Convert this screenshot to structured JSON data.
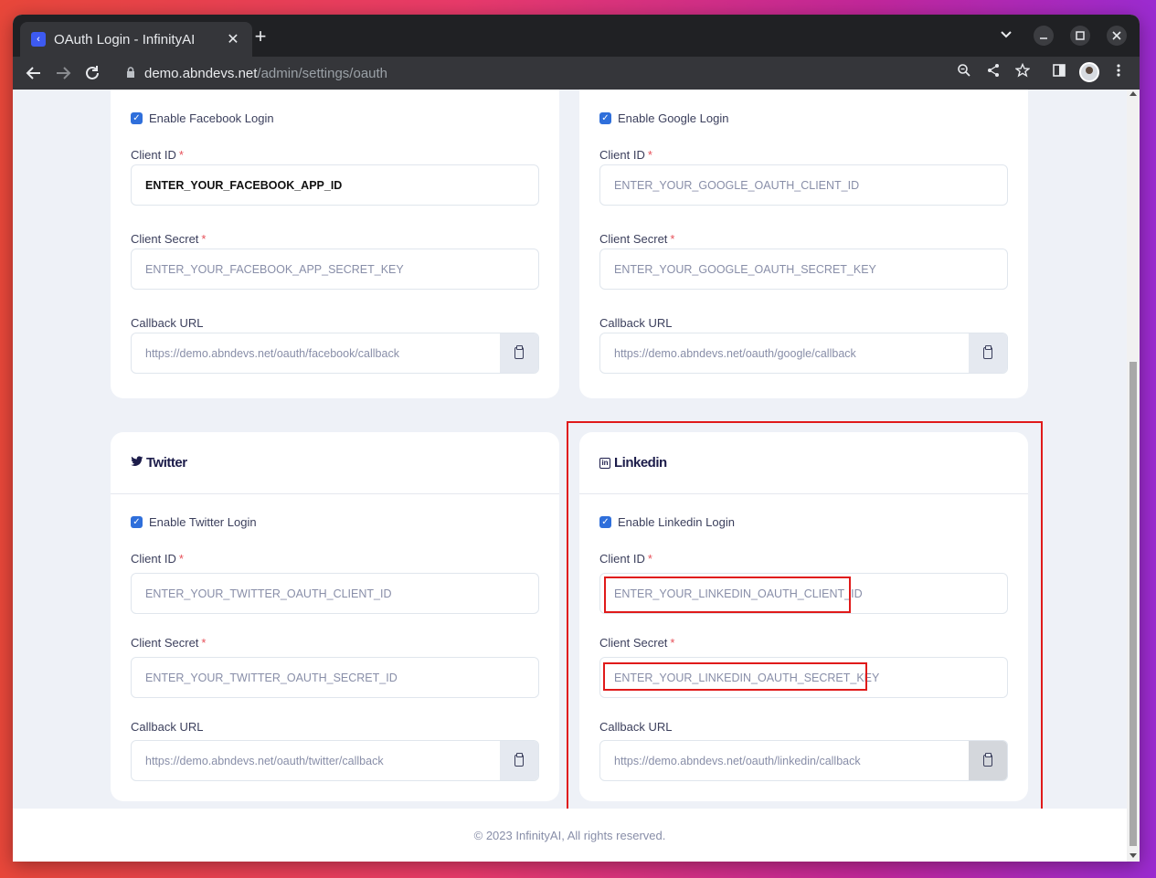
{
  "browser": {
    "tab_title": "OAuth Login - InfinityAI",
    "favicon_glyph": "‹",
    "close_glyph": "✕",
    "newtab_glyph": "+",
    "url_host": "demo.abndevs.net",
    "url_path": "/admin/settings/oauth",
    "icons": [
      "back-arrow-icon",
      "forward-arrow-icon",
      "reload-icon",
      "lock-icon",
      "zoom-icon",
      "share-icon",
      "star-icon",
      "sidepanel-icon",
      "profile-avatar",
      "menu-icon",
      "tab-search-icon",
      "minimize-icon",
      "maximize-icon",
      "window-close-icon"
    ]
  },
  "facebook": {
    "enable_label": "Enable Facebook Login",
    "enabled": true,
    "client_id_label": "Client ID",
    "client_id_value": "ENTER_YOUR_FACEBOOK_APP_ID",
    "client_secret_label": "Client Secret",
    "client_secret_value": "ENTER_YOUR_FACEBOOK_APP_SECRET_KEY",
    "callback_label": "Callback URL",
    "callback_value": "https://demo.abndevs.net/oauth/facebook/callback"
  },
  "google": {
    "enable_label": "Enable Google Login",
    "enabled": true,
    "client_id_label": "Client ID",
    "client_id_value": "ENTER_YOUR_GOOGLE_OAUTH_CLIENT_ID",
    "client_secret_label": "Client Secret",
    "client_secret_value": "ENTER_YOUR_GOOGLE_OAUTH_SECRET_KEY",
    "callback_label": "Callback URL",
    "callback_value": "https://demo.abndevs.net/oauth/google/callback"
  },
  "twitter": {
    "title": "Twitter",
    "enable_label": "Enable Twitter Login",
    "enabled": true,
    "client_id_label": "Client ID",
    "client_id_value": "ENTER_YOUR_TWITTER_OAUTH_CLIENT_ID",
    "client_secret_label": "Client Secret",
    "client_secret_value": "ENTER_YOUR_TWITTER_OAUTH_SECRET_ID",
    "callback_label": "Callback URL",
    "callback_value": "https://demo.abndevs.net/oauth/twitter/callback"
  },
  "linkedin": {
    "title": "Linkedin",
    "enable_label": "Enable Linkedin Login",
    "enabled": true,
    "client_id_label": "Client ID",
    "client_id_value": "ENTER_YOUR_LINKEDIN_OAUTH_CLIENT_ID",
    "client_secret_label": "Client Secret",
    "client_secret_value": "ENTER_YOUR_LINKEDIN_OAUTH_SECRET_KEY",
    "callback_label": "Callback URL",
    "callback_value": "https://demo.abndevs.net/oauth/linkedin/callback"
  },
  "required_mark": "*",
  "checkmark_glyph": "✓",
  "footer": {
    "text": "© 2023 InfinityAI, All rights reserved."
  },
  "colors": {
    "highlight": "#e01a1a",
    "checkbox": "#2f6fdb",
    "required": "#e7515a"
  }
}
